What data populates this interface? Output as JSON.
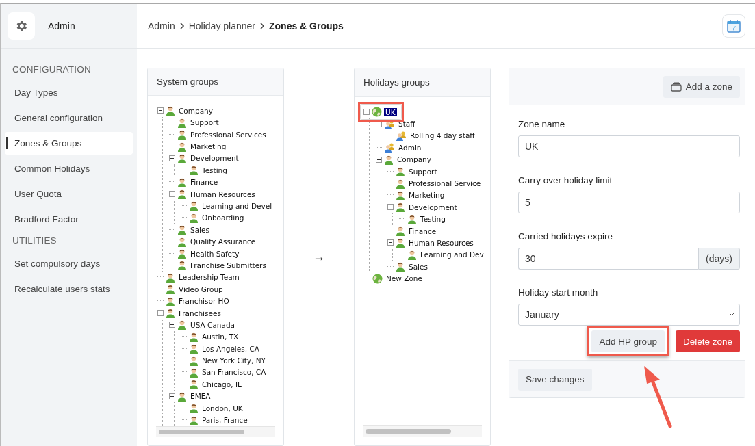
{
  "header": {
    "logo_label": "Admin",
    "breadcrumb": [
      {
        "label": "Admin",
        "current": false
      },
      {
        "label": "Holiday planner",
        "current": false
      },
      {
        "label": "Zones & Groups",
        "current": true
      }
    ]
  },
  "sidebar": {
    "sections": [
      {
        "heading": "CONFIGURATION",
        "items": [
          {
            "label": "Day Types",
            "selected": false
          },
          {
            "label": "General configuration",
            "selected": false
          },
          {
            "label": "Zones & Groups",
            "selected": true
          },
          {
            "label": "Common Holidays",
            "selected": false
          },
          {
            "label": "User Quota",
            "selected": false
          },
          {
            "label": "Bradford Factor",
            "selected": false
          }
        ]
      },
      {
        "heading": "UTILITIES",
        "items": [
          {
            "label": "Set compulsory days",
            "selected": false
          },
          {
            "label": "Recalculate users stats",
            "selected": false
          }
        ]
      }
    ]
  },
  "system_groups": {
    "title": "System groups",
    "tree": [
      {
        "label": "Company",
        "kind": "person",
        "expanded": true,
        "selected": false,
        "highlighted": false,
        "children": [
          {
            "label": "Support",
            "kind": "person",
            "selected": false,
            "highlighted": false
          },
          {
            "label": "Professional Services",
            "kind": "person",
            "selected": false,
            "highlighted": false
          },
          {
            "label": "Marketing",
            "kind": "person",
            "selected": false,
            "highlighted": false
          },
          {
            "label": "Development",
            "kind": "person",
            "expanded": true,
            "selected": false,
            "highlighted": false,
            "children": [
              {
                "label": "Testing",
                "kind": "person",
                "selected": false,
                "highlighted": false
              }
            ]
          },
          {
            "label": "Finance",
            "kind": "person",
            "selected": false,
            "highlighted": false
          },
          {
            "label": "Human Resources",
            "kind": "person",
            "expanded": true,
            "selected": false,
            "highlighted": false,
            "children": [
              {
                "label": "Learning and Devel",
                "kind": "person",
                "selected": false,
                "highlighted": false
              },
              {
                "label": "Onboarding",
                "kind": "person",
                "selected": false,
                "highlighted": false
              }
            ]
          },
          {
            "label": "Sales",
            "kind": "person",
            "selected": false,
            "highlighted": false
          },
          {
            "label": "Quality Assurance",
            "kind": "person",
            "selected": false,
            "highlighted": false
          },
          {
            "label": "Health Safety",
            "kind": "person",
            "selected": false,
            "highlighted": false
          },
          {
            "label": "Franchise Submitters",
            "kind": "person",
            "selected": false,
            "highlighted": false
          }
        ]
      },
      {
        "label": "Leadership Team",
        "kind": "person",
        "selected": false,
        "highlighted": false
      },
      {
        "label": "Video Group",
        "kind": "person",
        "selected": false,
        "highlighted": false
      },
      {
        "label": "Franchisor HQ",
        "kind": "person",
        "selected": false,
        "highlighted": false
      },
      {
        "label": "Franchisees",
        "kind": "person",
        "expanded": true,
        "selected": false,
        "highlighted": false,
        "children": [
          {
            "label": "USA Canada",
            "kind": "person",
            "expanded": true,
            "selected": false,
            "highlighted": false,
            "children": [
              {
                "label": "Austin, TX",
                "kind": "person",
                "selected": false,
                "highlighted": false
              },
              {
                "label": "Los Angeles, CA",
                "kind": "person",
                "selected": false,
                "highlighted": false
              },
              {
                "label": "New York City, NY",
                "kind": "person",
                "selected": false,
                "highlighted": false
              },
              {
                "label": "San Francisco, CA",
                "kind": "person",
                "selected": false,
                "highlighted": false
              },
              {
                "label": "Chicago, IL",
                "kind": "person",
                "selected": false,
                "highlighted": false
              }
            ]
          },
          {
            "label": "EMEA",
            "kind": "person",
            "expanded": true,
            "selected": false,
            "highlighted": false,
            "children": [
              {
                "label": "London, UK",
                "kind": "person",
                "selected": false,
                "highlighted": false
              },
              {
                "label": "Paris, France",
                "kind": "person",
                "selected": false,
                "highlighted": false
              }
            ]
          }
        ]
      }
    ]
  },
  "transfer_arrow": "→",
  "holidays_groups": {
    "title": "Holidays groups",
    "tree": [
      {
        "label": "UK",
        "kind": "globe",
        "expanded": true,
        "selected": true,
        "highlighted": true,
        "children": [
          {
            "label": "Staff",
            "kind": "group",
            "expanded": true,
            "selected": false,
            "highlighted": false,
            "children": [
              {
                "label": "Rolling 4 day staff",
                "kind": "group",
                "selected": false,
                "highlighted": false
              }
            ]
          },
          {
            "label": "Admin",
            "kind": "group",
            "selected": false,
            "highlighted": false
          },
          {
            "label": "Company",
            "kind": "person",
            "expanded": true,
            "selected": false,
            "highlighted": false,
            "children": [
              {
                "label": "Support",
                "kind": "person",
                "selected": false,
                "highlighted": false
              },
              {
                "label": "Professional Service",
                "kind": "person",
                "selected": false,
                "highlighted": false
              },
              {
                "label": "Marketing",
                "kind": "person",
                "selected": false,
                "highlighted": false
              },
              {
                "label": "Development",
                "kind": "person",
                "expanded": true,
                "selected": false,
                "highlighted": false,
                "children": [
                  {
                    "label": "Testing",
                    "kind": "person",
                    "selected": false,
                    "highlighted": false
                  }
                ]
              },
              {
                "label": "Finance",
                "kind": "person",
                "selected": false,
                "highlighted": false
              },
              {
                "label": "Human Resources",
                "kind": "person",
                "expanded": true,
                "selected": false,
                "highlighted": false,
                "children": [
                  {
                    "label": "Learning and Dev",
                    "kind": "person",
                    "selected": false,
                    "highlighted": false
                  }
                ]
              },
              {
                "label": "Sales",
                "kind": "person",
                "selected": false,
                "highlighted": false
              }
            ]
          }
        ]
      },
      {
        "label": "New Zone",
        "kind": "globe",
        "selected": false,
        "highlighted": false
      }
    ]
  },
  "zone_form": {
    "add_zone_button": "Add a zone",
    "fields": [
      {
        "label": "Zone name",
        "value": "UK",
        "kind": "text"
      },
      {
        "label": "Carry over holiday limit",
        "value": "5",
        "kind": "text"
      },
      {
        "label": "Carried holidays expire",
        "value": "30",
        "suffix": "(days)",
        "kind": "suffixed"
      },
      {
        "label": "Holiday start month",
        "value": "January",
        "kind": "select"
      }
    ],
    "buttons": [
      {
        "label": "Add HP group",
        "kind": "secondary",
        "highlighted": true
      },
      {
        "label": "Delete zone",
        "kind": "danger",
        "highlighted": false
      }
    ],
    "save_button": "Save changes"
  },
  "annotation_arrow": true
}
